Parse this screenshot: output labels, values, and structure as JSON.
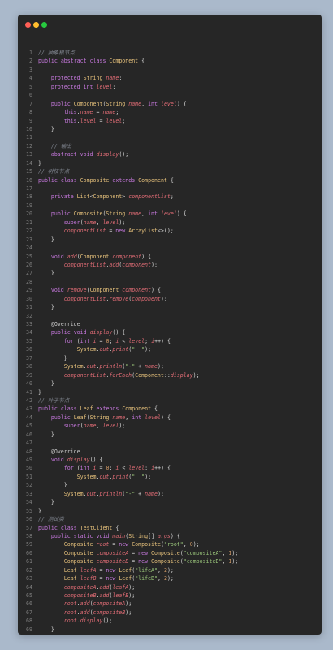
{
  "window": {
    "buttons": [
      "close",
      "minimize",
      "maximize"
    ]
  },
  "code": {
    "lines": [
      "// 抽象根节点",
      "public abstract class Component {",
      "",
      "    protected String name;",
      "    protected int level;",
      "",
      "    public Component(String name, int level) {",
      "        this.name = name;",
      "        this.level = level;",
      "    }",
      "",
      "    // 输出",
      "    abstract void display();",
      "}",
      "// 树枝节点",
      "public class Composite extends Component {",
      "",
      "    private List<Component> componentList;",
      "",
      "    public Composite(String name, int level) {",
      "        super(name, level);",
      "        componentList = new ArrayList<>();",
      "    }",
      "",
      "    void add(Component component) {",
      "        componentList.add(component);",
      "    }",
      "",
      "    void remove(Component component) {",
      "        componentList.remove(component);",
      "    }",
      "",
      "    @Override",
      "    public void display() {",
      "        for (int i = 0; i < level; i++) {",
      "            System.out.print(\"  \");",
      "        }",
      "        System.out.println(\"-\" + name);",
      "        componentList.forEach(Component::display);",
      "    }",
      "}",
      "// 叶子节点",
      "public class Leaf extends Component {",
      "    public Leaf(String name, int level) {",
      "        super(name, level);",
      "    }",
      "",
      "    @Override",
      "    void display() {",
      "        for (int i = 0; i < level; i++) {",
      "            System.out.print(\"  \");",
      "        }",
      "        System.out.println(\"-\" + name);",
      "    }",
      "}",
      "// 测试类",
      "public class TestClient {",
      "    public static void main(String[] args) {",
      "        Composite root = new Composite(\"root\", 0);",
      "        Composite compositeA = new Composite(\"compositeA\", 1);",
      "        Composite compositeB = new Composite(\"compositeB\", 1);",
      "        Leaf leafA = new Leaf(\"lifeA\", 2);",
      "        Leaf leafB = new Leaf(\"lifeB\", 2);",
      "        compositeA.add(leafA);",
      "        compositeB.add(leafB);",
      "        root.add(compositeA);",
      "        root.add(compositeB);",
      "        root.display();",
      "    }",
      "}"
    ]
  }
}
